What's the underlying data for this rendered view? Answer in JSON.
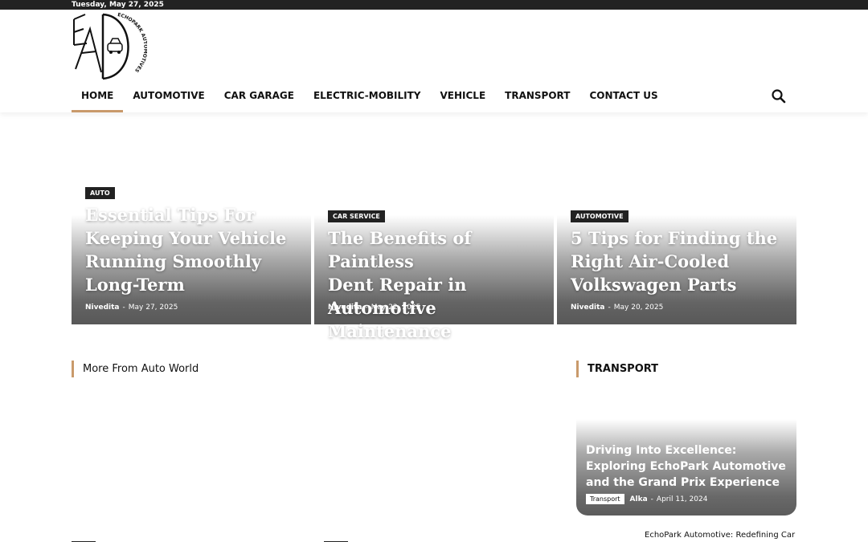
{
  "topbar": {
    "date": "Tuesday, May 27, 2025"
  },
  "logo": {
    "text": "ECHOPARK AUTOMOTIVES"
  },
  "nav": {
    "items": [
      {
        "label": "HOME"
      },
      {
        "label": "AUTOMOTIVE"
      },
      {
        "label": "CAR GARAGE"
      },
      {
        "label": "ELECTRIC-MOBILITY"
      },
      {
        "label": "VEHICLE"
      },
      {
        "label": "TRANSPORT"
      },
      {
        "label": "CONTACT US"
      }
    ],
    "search_icon": "search-icon"
  },
  "featured": [
    {
      "tag": "AUTO",
      "title_lines": [
        "Essential Tips For",
        "Keeping Your Vehicle",
        "Running Smoothly",
        "Long-Term"
      ],
      "author": "Nivedita",
      "sep": "-",
      "date": "May 27, 2025"
    },
    {
      "tag": "CAR SERVICE",
      "title_lines": [
        "The Benefits of Paintless",
        "Dent Repair in",
        "Automotive Maintenance"
      ],
      "author": "Nivedita",
      "sep": "-",
      "date": "May 22, 2025"
    },
    {
      "tag": "AUTOMOTIVE",
      "title_lines": [
        "5 Tips for Finding the",
        "Right Air-Cooled",
        "Volkswagen Parts"
      ],
      "author": "Nivedita",
      "sep": "-",
      "date": "May 20, 2025"
    }
  ],
  "sections": {
    "more": "More From Auto World",
    "transport": "TRANSPORT"
  },
  "transport_post": {
    "title": "Driving Into Excellence: Exploring EchoPark Automotive and the Grand Prix Experience",
    "tag": "Transport",
    "author": "Alka",
    "sep": "-",
    "date": "April 11, 2024"
  },
  "bottom_link": "EchoPark Automotive: Redefining Car",
  "colors": {
    "accent": "#c99a6b",
    "topbar": "#222222"
  }
}
